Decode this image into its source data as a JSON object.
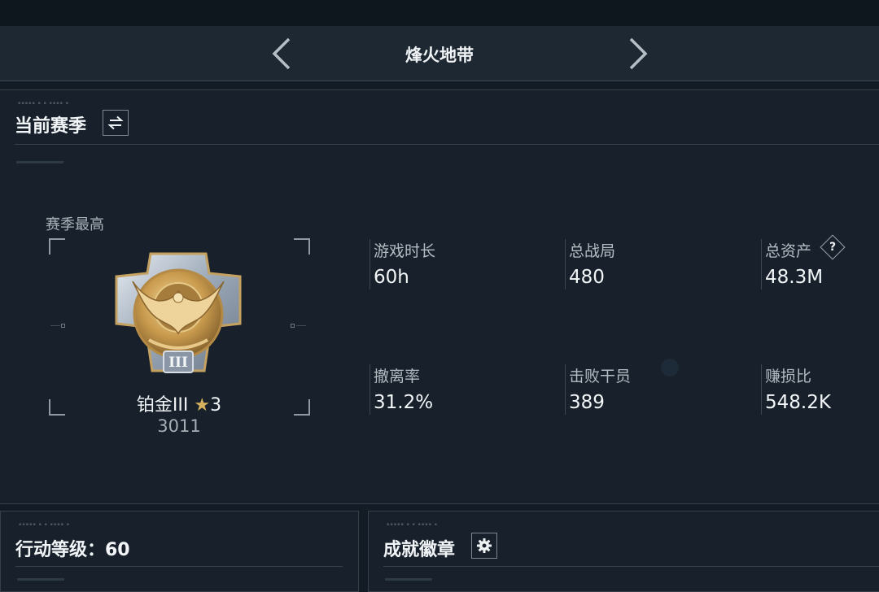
{
  "header": {
    "title": "烽火地带",
    "prev_icon": "chevron-left-icon",
    "next_icon": "chevron-right-icon"
  },
  "current_season": {
    "title": "当前赛季",
    "switch_icon": "swap-arrows-icon"
  },
  "season_best": {
    "label": "赛季最高",
    "rank_name": "铂金III",
    "star_icon": "star-icon",
    "stars": "3",
    "score": "3011",
    "medal_icon": "eagle-medal-icon",
    "medal_numeral": "III"
  },
  "stats": [
    {
      "label": "游戏时长",
      "value": "60h"
    },
    {
      "label": "总战局",
      "value": "480"
    },
    {
      "label": "总资产",
      "value": "48.3M"
    },
    {
      "label": "撤离率",
      "value": "31.2%"
    },
    {
      "label": "击败干员",
      "value": "389"
    },
    {
      "label": "赚损比",
      "value": "548.2K"
    }
  ],
  "help_icon": "question-icon",
  "help_glyph": "?",
  "action_level": {
    "title": "行动等级：60"
  },
  "achievements": {
    "title": "成就徽章",
    "settings_icon": "gear-icon"
  },
  "colors": {
    "background": "#131c25",
    "panel": "#18212b",
    "header": "#1e2832",
    "gold": "#d6b15e",
    "text": "#f0f3f5",
    "muted": "#a9b2b9"
  }
}
